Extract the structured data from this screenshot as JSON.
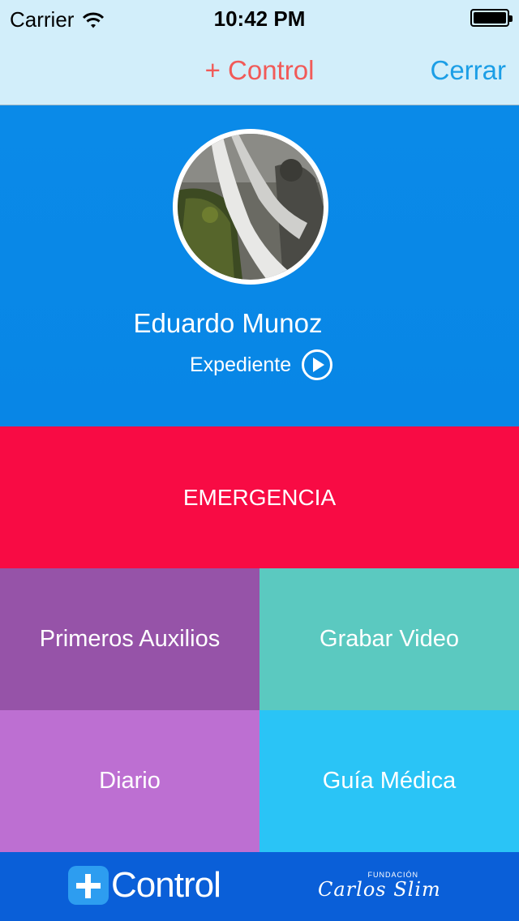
{
  "status_bar": {
    "carrier": "Carrier",
    "time": "10:42 PM"
  },
  "nav": {
    "title": "+ Control",
    "close": "Cerrar"
  },
  "profile": {
    "name": "Eduardo Munoz",
    "expediente": "Expediente"
  },
  "tiles": {
    "emergency": "EMERGENCIA",
    "first_aid": "Primeros Auxilios",
    "record_video": "Grabar Video",
    "diary": "Diario",
    "medical_guide": "Guía Médica"
  },
  "footer": {
    "logo_text": "Control",
    "sponsor_small": "FUNDACIÓN",
    "sponsor_name": "Carlos Slim"
  }
}
